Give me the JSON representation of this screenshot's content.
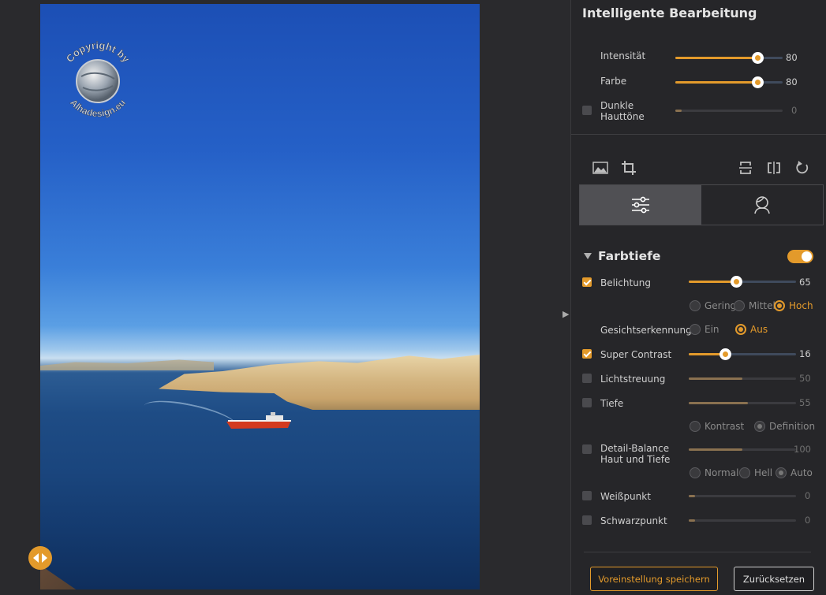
{
  "panel": {
    "title": "Intelligente Bearbeitung",
    "smart": [
      {
        "label": "Intensität",
        "value": "80",
        "level": 0.76,
        "enabled": true
      },
      {
        "label": "Farbe",
        "value": "80",
        "level": 0.76,
        "enabled": true
      },
      {
        "label": "Dunkle Hauttöne",
        "value": "0",
        "level": 0.05,
        "enabled": false
      }
    ],
    "tools": [
      "image-icon",
      "crop-icon",
      "flip-vertical-icon",
      "flip-horizontal-icon",
      "rotate-icon"
    ],
    "tabs": [
      "sliders-icon",
      "portrait-icon"
    ],
    "section": {
      "title": "Farbtiefe",
      "enabled": true,
      "belichtung": {
        "label": "Belichtung",
        "value": "65",
        "level": 0.44,
        "checked": true,
        "options": [
          "Gering",
          "Mittel",
          "Hoch"
        ],
        "selected": "Hoch"
      },
      "gesicht": {
        "label": "Gesichtserkennung",
        "options": [
          "Ein",
          "Aus"
        ],
        "selected": "Aus"
      },
      "contrast": {
        "label": "Super Contrast",
        "value": "16",
        "level": 0.34,
        "checked": true
      },
      "licht": {
        "label": "Lichtstreuung",
        "value": "50",
        "level": 0.5,
        "checked": false
      },
      "tiefe": {
        "label": "Tiefe",
        "value": "55",
        "level": 0.55,
        "checked": false,
        "options": [
          "Kontrast",
          "Definition"
        ],
        "selected": "Definition"
      },
      "detail": {
        "label": "Detail-Balance Haut und Tiefe",
        "value": "100",
        "level": 0.5,
        "checked": false,
        "options": [
          "Normal",
          "Hell",
          "Auto"
        ],
        "selected": "Auto"
      },
      "weiss": {
        "label": "Weißpunkt",
        "value": "0",
        "level": 0.05,
        "checked": false
      },
      "schwarz": {
        "label": "Schwarzpunkt",
        "value": "0",
        "level": 0.05,
        "checked": false
      }
    },
    "buttons": {
      "save": "Voreinstellung speichern",
      "reset": "Zurücksetzen"
    }
  },
  "watermark": {
    "text_top": "Copyright by",
    "text_bottom": "Alhadesign.eu"
  },
  "colors": {
    "accent": "#e39a2b",
    "panel_bg": "#262629",
    "canvas_bg": "#2a2a2d"
  }
}
